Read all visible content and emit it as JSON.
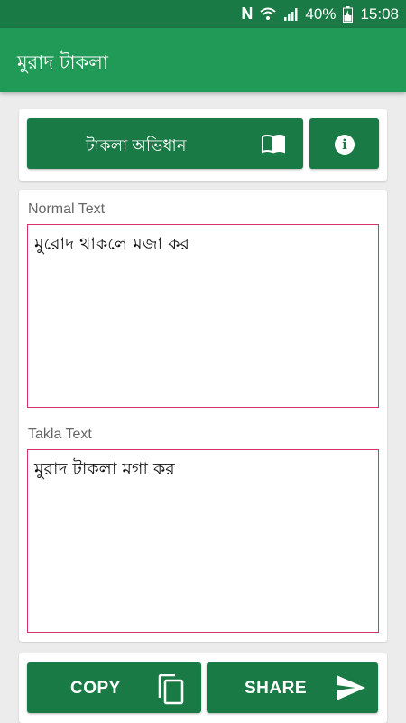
{
  "status_bar": {
    "notification_icon": "N",
    "battery": "40%",
    "time": "15:08"
  },
  "app_bar": {
    "title": "মুরাদ টাকলা"
  },
  "top_actions": {
    "dictionary_label": "টাকলা অভিধান",
    "dictionary_icon": "book-icon",
    "info_icon": "info-icon"
  },
  "converter": {
    "normal_label": "Normal Text",
    "normal_value": "মুরোদ থাকলে মজা কর",
    "takla_label": "Takla Text",
    "takla_value": "মুরাদ টাকলা মগা কর"
  },
  "bottom_actions": {
    "copy_label": "COPY",
    "copy_icon": "copy-icon",
    "share_label": "SHARE",
    "share_icon": "send-icon"
  },
  "colors": {
    "status_bar": "#1a7a45",
    "app_bar": "#219a58",
    "button": "#1a7a45",
    "field_border": "#d6336c"
  }
}
